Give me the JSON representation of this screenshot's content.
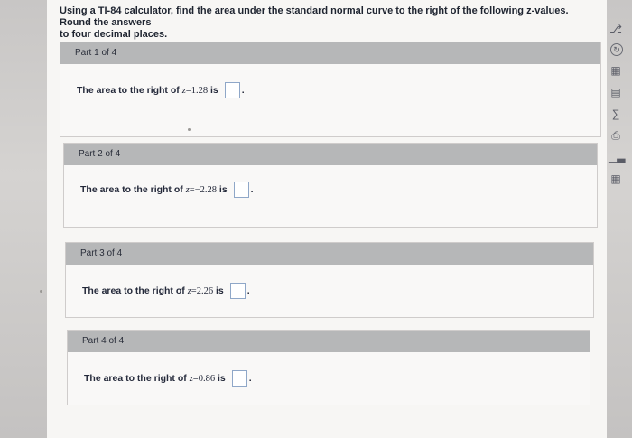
{
  "question": {
    "line1": "Using a TI-84 calculator, find the area under the standard normal curve to the right of the following z-values. Round the answers",
    "line2": "to four decimal places."
  },
  "parts": [
    {
      "label": "Part 1 of 4",
      "prefix": "The area to the right of",
      "var": "z",
      "eq": "=",
      "value": "1.28",
      "suffix": "is"
    },
    {
      "label": "Part 2 of 4",
      "prefix": "The area to the right of",
      "var": "z",
      "eq": "=",
      "value": "−2.28",
      "suffix": "is"
    },
    {
      "label": "Part 3 of 4",
      "prefix": "The area to the right of",
      "var": "z",
      "eq": "=",
      "value": "2.26",
      "suffix": "is"
    },
    {
      "label": "Part 4 of 4",
      "prefix": "The area to the right of",
      "var": "z",
      "eq": "=",
      "value": "0.86",
      "suffix": "is"
    }
  ],
  "toolbar": {
    "icons": [
      "key-icon",
      "refresh-icon",
      "calculator-icon",
      "table-icon",
      "formula-icon",
      "print-icon",
      "chart-icon",
      "grid-icon"
    ]
  }
}
